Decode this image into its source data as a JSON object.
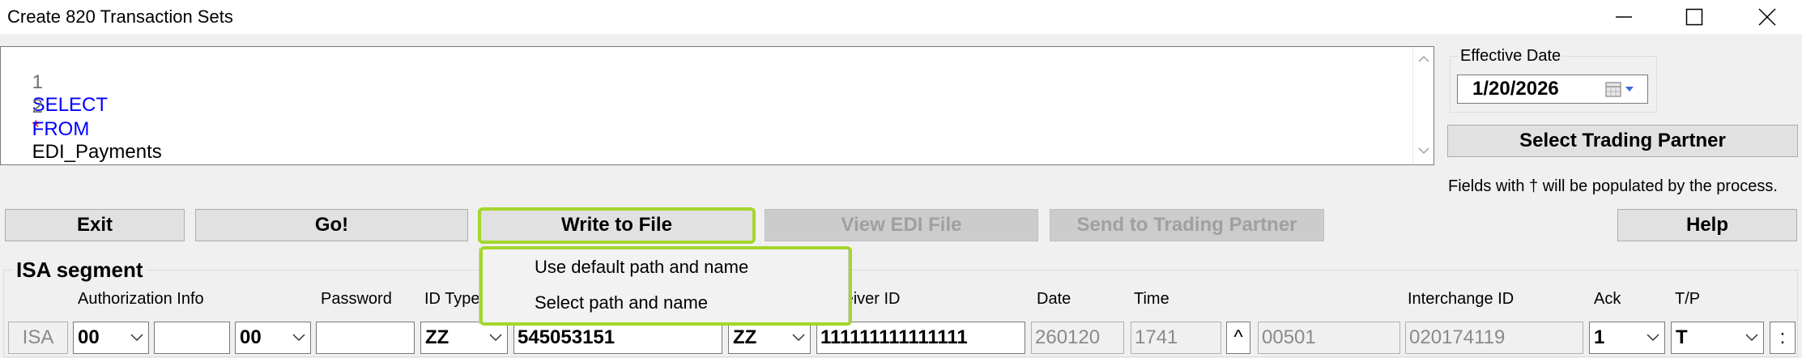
{
  "window": {
    "title": "Create 820 Transaction Sets",
    "controls": [
      "minimize-icon",
      "maximize-icon",
      "close-icon"
    ]
  },
  "editor": {
    "lines": [
      {
        "number": "1",
        "keyword": "SELECT",
        "rest": "*"
      },
      {
        "number": "2",
        "keyword": "FROM",
        "rest": "EDI_Payments"
      }
    ]
  },
  "effective_date": {
    "label": "Effective Date",
    "value": "1/20/2026",
    "icon": "calendar-icon"
  },
  "select_partner_label": "Select Trading Partner",
  "note": "Fields with † will be populated by the process.",
  "toolbar": {
    "exit": "Exit",
    "go": "Go!",
    "write": "Write to File",
    "view": "View EDI File",
    "send": "Send to Trading Partner",
    "help": "Help"
  },
  "write_menu": {
    "items": [
      "Use default path and name",
      "Select path and name"
    ]
  },
  "isa": {
    "title": "ISA segment",
    "labels": {
      "auth": "Authorization Info",
      "password": "Password",
      "idtype": "ID Type",
      "receiver": "Receiver ID",
      "date": "Date",
      "time": "Time",
      "interchange": "Interchange ID",
      "ack": "Ack",
      "tp": "T/P"
    },
    "values": {
      "segment": "ISA",
      "auth_qual": "00",
      "auth_info": "",
      "pwd_qual": "00",
      "password": "",
      "sender_qual": "ZZ",
      "sender_id": "545053151",
      "receiver_qual": "ZZ",
      "receiver_id": "111111111111111",
      "date": "260120",
      "time": "1741",
      "repetition": "^",
      "version": "00501",
      "interchange_id": "020174119",
      "ack": "1",
      "tp": "T",
      "separator": ":"
    }
  },
  "colors": {
    "keyword": "#0000ff",
    "required_mark": "#ff0000",
    "highlight": "#a4d62c",
    "disabled_text": "#a0a0a0"
  }
}
